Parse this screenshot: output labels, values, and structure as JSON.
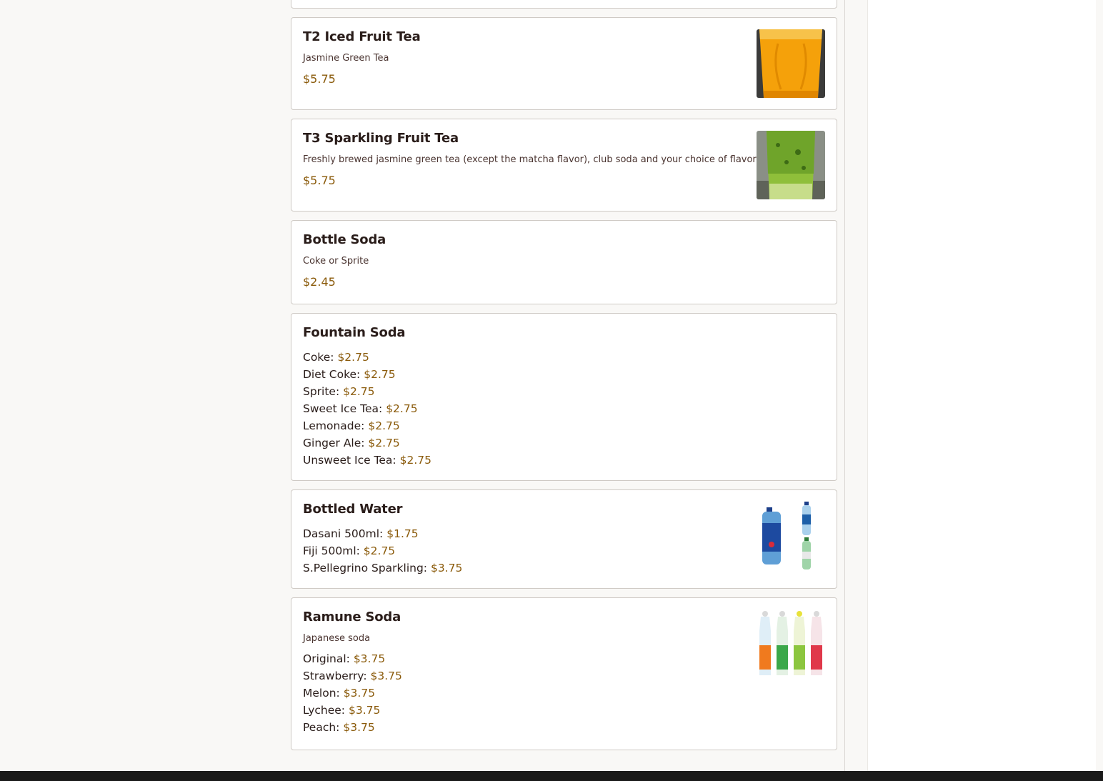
{
  "menu": {
    "items": [
      {
        "name": "T2 Iced Fruit Tea",
        "description": "Jasmine Green Tea",
        "price": "$5.75",
        "image": "orange-iced-tea-photo"
      },
      {
        "name": "T3 Sparkling Fruit Tea",
        "description": "Freshly brewed jasmine green tea (except the matcha flavor), club soda and your choice of flavor",
        "price": "$5.75",
        "image": "matcha-sparkling-tea-photo"
      },
      {
        "name": "Bottle Soda",
        "description": "Coke or Sprite",
        "price": "$2.45"
      },
      {
        "name": "Fountain Soda",
        "options": [
          {
            "label": "Coke:",
            "price": "$2.75"
          },
          {
            "label": "Diet Coke:",
            "price": "$2.75"
          },
          {
            "label": "Sprite:",
            "price": "$2.75"
          },
          {
            "label": "Sweet Ice Tea:",
            "price": "$2.75"
          },
          {
            "label": "Lemonade:",
            "price": "$2.75"
          },
          {
            "label": "Ginger Ale:",
            "price": "$2.75"
          },
          {
            "label": "Unsweet Ice Tea:",
            "price": "$2.75"
          }
        ]
      },
      {
        "name": "Bottled Water",
        "image": "water-bottles-photo",
        "options": [
          {
            "label": "Dasani 500ml:",
            "price": "$1.75"
          },
          {
            "label": "Fiji 500ml:",
            "price": "$2.75"
          },
          {
            "label": "S.Pellegrino Sparkling:",
            "price": "$3.75"
          }
        ]
      },
      {
        "name": "Ramune Soda",
        "description": "Japanese soda",
        "image": "ramune-bottles-photo",
        "options": [
          {
            "label": "Original:",
            "price": "$3.75"
          },
          {
            "label": "Strawberry:",
            "price": "$3.75"
          },
          {
            "label": "Melon:",
            "price": "$3.75"
          },
          {
            "label": "Lychee:",
            "price": "$3.75"
          },
          {
            "label": "Peach:",
            "price": "$3.75"
          }
        ]
      }
    ]
  },
  "colors": {
    "price": "#8a5a0a",
    "title": "#2a1d1a",
    "card_border": "#cfcac5",
    "background": "#f9f8f6",
    "footer": "#1a1a1a"
  }
}
